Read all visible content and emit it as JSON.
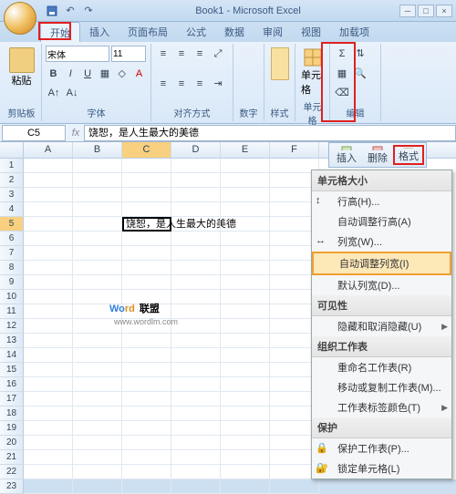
{
  "title": "Book1 - Microsoft Excel",
  "tabs": [
    "开始",
    "插入",
    "页面布局",
    "公式",
    "数据",
    "审阅",
    "视图",
    "加载项"
  ],
  "activeTab": 0,
  "ribbon": {
    "clipboard": {
      "label": "剪贴板",
      "paste": "粘贴"
    },
    "font": {
      "label": "字体",
      "name": "宋体",
      "size": "11",
      "bold": "B",
      "italic": "I",
      "underline": "U"
    },
    "align": {
      "label": "对齐方式"
    },
    "number": {
      "label": "数字"
    },
    "style": {
      "label": "样式"
    },
    "cell": {
      "label": "单元格",
      "btn": "单元格"
    },
    "edit": {
      "label": "编辑"
    }
  },
  "namebox": "C5",
  "fx": "fx",
  "formula": "饶恕，是人生最大的美德",
  "cols": [
    "A",
    "B",
    "C",
    "D",
    "E",
    "F"
  ],
  "activeCol": 2,
  "rowCount": 23,
  "activeRow": 5,
  "cellC5": "饶恕，是人生最大的美德",
  "watermark": {
    "w": "Wo",
    "rd": "rd",
    "lm": "联盟",
    "url": "www.wordlm.com"
  },
  "mini": {
    "insert": "插入",
    "delete": "删除",
    "format": "格式"
  },
  "ctx": {
    "sec1": "单元格大小",
    "rowH": "行高(H)...",
    "autoRowH": "自动调整行高(A)",
    "colW": "列宽(W)...",
    "autoColW": "自动调整列宽(I)",
    "defW": "默认列宽(D)...",
    "sec2": "可见性",
    "hide": "隐藏和取消隐藏(U)",
    "sec3": "组织工作表",
    "rename": "重命名工作表(R)",
    "move": "移动或复制工作表(M)...",
    "tabColor": "工作表标签颜色(T)",
    "sec4": "保护",
    "protect": "保护工作表(P)...",
    "lock": "锁定单元格(L)"
  }
}
